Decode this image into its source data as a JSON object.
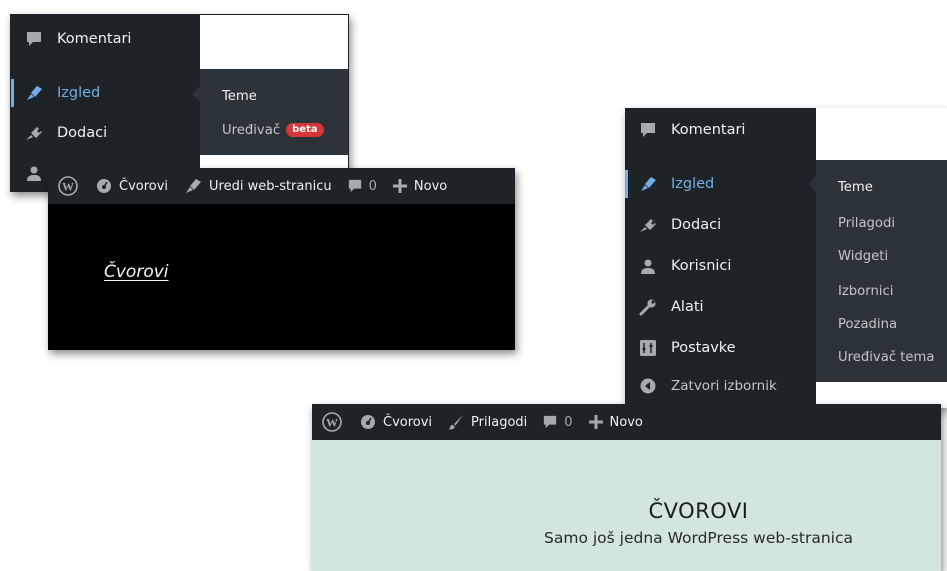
{
  "left_panel": {
    "menu": [
      {
        "label": "Komentari",
        "icon": "comment-icon"
      },
      {
        "label": "Izgled",
        "icon": "appearance-icon",
        "active": true
      },
      {
        "label": "Dodaci",
        "icon": "plugins-icon"
      }
    ],
    "submenu": {
      "theme": "Teme",
      "editor": "Uređivač",
      "editor_badge": "beta"
    }
  },
  "left_site": {
    "adminbar": {
      "site": "Čvorovi",
      "edit_site": "Uredi web-stranicu",
      "comments": "0",
      "new": "Novo"
    },
    "site_title": "Čvorovi"
  },
  "right_panel": {
    "menu": [
      {
        "label": "Komentari",
        "icon": "comment-icon"
      },
      {
        "label": "Izgled",
        "icon": "appearance-icon",
        "active": true
      },
      {
        "label": "Dodaci",
        "icon": "plugins-icon"
      },
      {
        "label": "Korisnici",
        "icon": "users-icon"
      },
      {
        "label": "Alati",
        "icon": "tools-icon"
      },
      {
        "label": "Postavke",
        "icon": "settings-icon"
      },
      {
        "label": "Zatvori izbornik",
        "icon": "collapse-icon"
      }
    ],
    "submenu": [
      "Teme",
      "Prilagodi",
      "Widgeti",
      "Izbornici",
      "Pozadina",
      "Uređivač tema"
    ]
  },
  "right_site": {
    "adminbar": {
      "site": "Čvorovi",
      "customize": "Prilagodi",
      "comments": "0",
      "new": "Novo"
    },
    "site_title": "ČVOROVI",
    "tagline": "Samo još jedna WordPress web-stranica"
  },
  "colors": {
    "admin_dark": "#1d2327",
    "submenu_bg": "#2c3338",
    "accent": "#72aee6",
    "badge": "#d63638",
    "site_mint": "#d3e6de"
  }
}
